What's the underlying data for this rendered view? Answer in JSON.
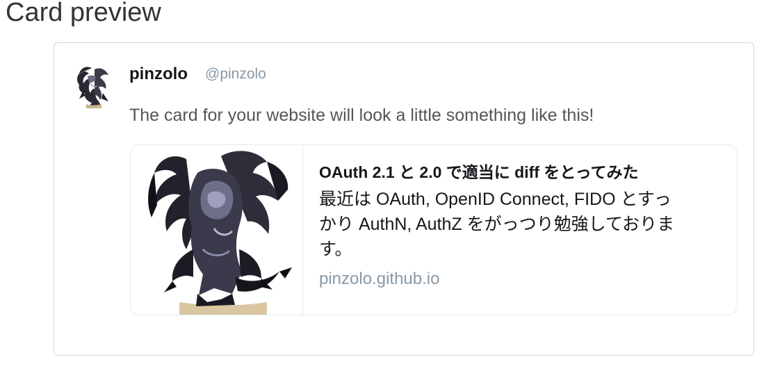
{
  "page": {
    "title": "Card preview"
  },
  "tweet": {
    "author_name": "pinzolo",
    "author_handle": "@pinzolo",
    "avatar_icon": "gargoyle-avatar-icon",
    "text": "The card for your website will look a little something like this!"
  },
  "card": {
    "image_icon": "gargoyle-illustration-icon",
    "title": "OAuth 2.1 と 2.0 で適当に diff をとってみた",
    "description": "最近は OAuth, OpenID Connect, FIDO とすっ\nかり AuthN, AuthZ をがっつり勉強しておりま\nす。",
    "domain": "pinzolo.github.io"
  },
  "colors": {
    "name_text": "#14171a",
    "muted_text": "#8899a6",
    "body_text": "#555555",
    "card_border": "#e1e8ed",
    "frame_border": "#d6d6d6"
  }
}
